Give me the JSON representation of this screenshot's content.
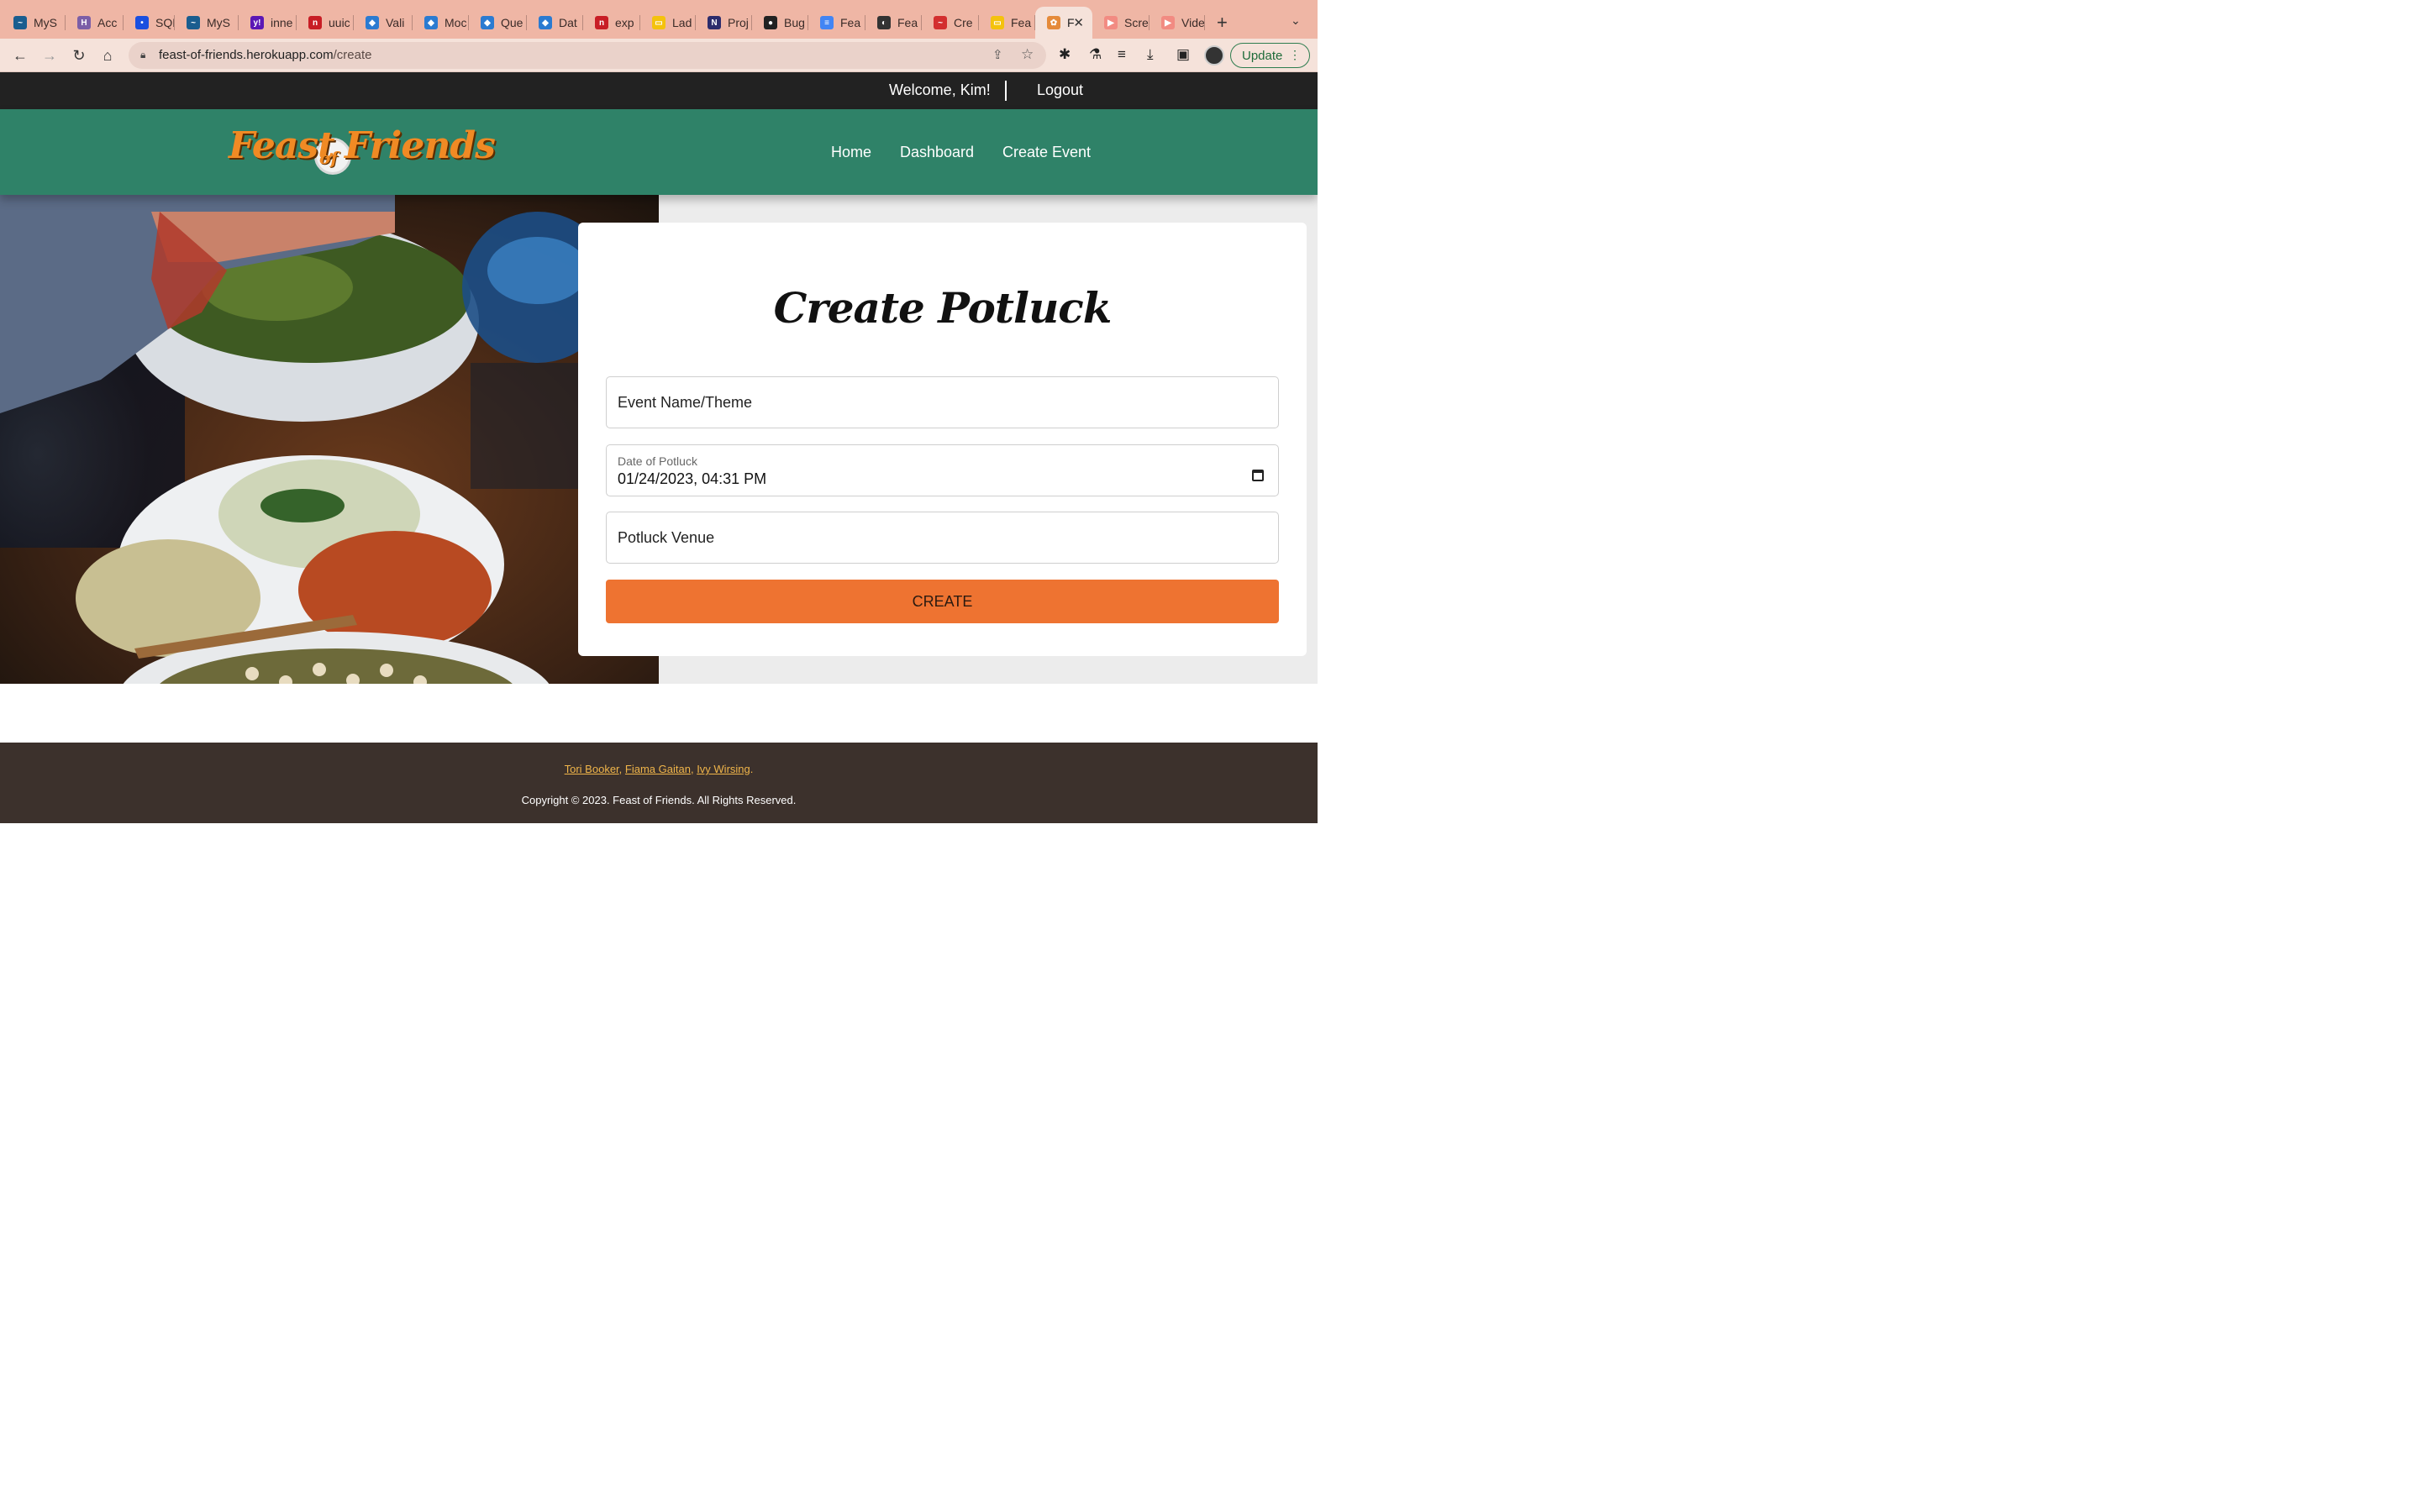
{
  "browser": {
    "tabs": [
      {
        "label": "MyS",
        "color": "#1a5d8f",
        "glyph": "~"
      },
      {
        "label": "Acc",
        "color": "#7b5ea7",
        "glyph": "H"
      },
      {
        "label": "SQL",
        "color": "#1a4fe0",
        "glyph": "•"
      },
      {
        "label": "MyS",
        "color": "#1a5d8f",
        "glyph": "~"
      },
      {
        "label": "inne",
        "color": "#5b17b5",
        "glyph": "y!"
      },
      {
        "label": "uuic",
        "color": "#c81d25",
        "glyph": "n"
      },
      {
        "label": "Vali",
        "color": "#2b7bd1",
        "glyph": "◆"
      },
      {
        "label": "Moc",
        "color": "#2b7bd1",
        "glyph": "◆"
      },
      {
        "label": "Que",
        "color": "#2b7bd1",
        "glyph": "◆"
      },
      {
        "label": "Dat",
        "color": "#2b7bd1",
        "glyph": "◆"
      },
      {
        "label": "exp",
        "color": "#c81d25",
        "glyph": "n"
      },
      {
        "label": "Lad",
        "color": "#f4c20d",
        "glyph": "▭"
      },
      {
        "label": "Proj",
        "color": "#2c2c6c",
        "glyph": "N"
      },
      {
        "label": "Bug",
        "color": "#222222",
        "glyph": "●"
      },
      {
        "label": "Fea",
        "color": "#4285f4",
        "glyph": "≡"
      },
      {
        "label": "Fea",
        "color": "#333333",
        "glyph": "◐"
      },
      {
        "label": "Cre",
        "color": "#d32f2f",
        "glyph": "~"
      },
      {
        "label": "Fea",
        "color": "#f4c20d",
        "glyph": "▭"
      },
      {
        "label": "F",
        "color": "#e58a3a",
        "glyph": "✿",
        "active": true
      },
      {
        "label": "Scre",
        "color": "#f28b82",
        "glyph": "▶"
      },
      {
        "label": "Vide",
        "color": "#f28b82",
        "glyph": "▶"
      }
    ],
    "url_host": "feast-of-friends.herokuapp.com",
    "url_path": "/create",
    "update_label": "Update"
  },
  "topbar": {
    "welcome": "Welcome, Kim!",
    "logout": "Logout"
  },
  "header": {
    "logo_word1": "Feast",
    "logo_word2": "of",
    "logo_word3": "Friends",
    "nav": [
      "Home",
      "Dashboard",
      "Create Event"
    ]
  },
  "form": {
    "title": "Create Potluck",
    "event_name_placeholder": "Event Name/Theme",
    "date_label": "Date of Potluck",
    "date_value": "01/24/2023, 04:31 PM",
    "venue_placeholder": "Potluck Venue",
    "submit_label": "CREATE"
  },
  "footer": {
    "authors": [
      "Tori Booker",
      "Fiama Gaitan",
      "Ivy Wirsing"
    ],
    "copyright": "Copyright © 2023. Feast of Friends. All Rights Reserved."
  },
  "colors": {
    "tabstrip": "#efb6a5",
    "topbar": "#222222",
    "header": "#2f8268",
    "accent": "#ee7331",
    "footer": "#3c312c",
    "footer_link": "#f0b54a"
  }
}
